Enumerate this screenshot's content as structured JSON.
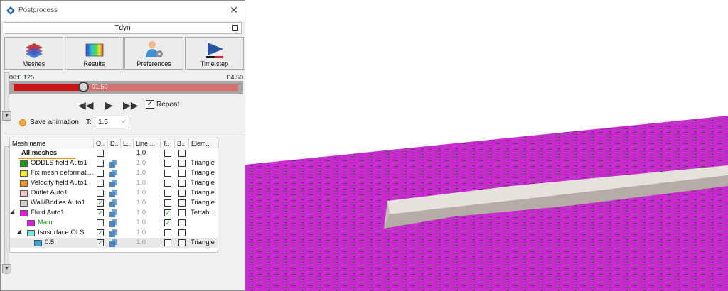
{
  "window": {
    "title": "Postprocess",
    "close_glyph": "✕"
  },
  "model": {
    "name": "Tdyn"
  },
  "toolbar": [
    {
      "label": "Meshes",
      "icon": "layers-icon"
    },
    {
      "label": "Results",
      "icon": "gradient-icon"
    },
    {
      "label": "Preferences",
      "icon": "user-gear-icon"
    },
    {
      "label": "Time step",
      "icon": "play-progress-icon"
    }
  ],
  "timeline": {
    "start": "00:0.125",
    "end": "04.50",
    "current": "01.50",
    "progress": 0.31
  },
  "playback": {
    "rewind": "◀◀",
    "play": "▶",
    "forward": "▶▶",
    "repeat_label": "Repeat",
    "repeat_checked": true
  },
  "animation": {
    "save_label": "Save animation",
    "t_label": "T:",
    "t_value": "1.5"
  },
  "table": {
    "headers": [
      "Mesh name",
      "O..",
      "D..",
      "L..",
      "Line ...",
      "T..",
      "B..",
      "Elem..."
    ],
    "all_meshes": {
      "label": "All meshes",
      "line": "1.0"
    },
    "rows": [
      {
        "name": "ODDLS field Auto1",
        "color": "#1a9b1a",
        "o": false,
        "line": "1.0",
        "t": false,
        "b": false,
        "elem": "Triangle",
        "indent": 0
      },
      {
        "name": "Fix mesh deformati...",
        "color": "#f5f032",
        "o": false,
        "line": "1.0",
        "t": false,
        "b": false,
        "elem": "Triangle",
        "indent": 0
      },
      {
        "name": "Velocity field Auto1",
        "color": "#f59a2a",
        "o": false,
        "line": "1.0",
        "t": false,
        "b": false,
        "elem": "Triangle",
        "indent": 0
      },
      {
        "name": "Outlet Auto1",
        "color": "#f7c8c8",
        "o": false,
        "line": "1.0",
        "t": false,
        "b": false,
        "elem": "Triangle",
        "indent": 0
      },
      {
        "name": "Wall/Bodies Auto1",
        "color": "#d8cfc0",
        "o": true,
        "line": "1.0",
        "t": false,
        "b": false,
        "elem": "Triangle",
        "indent": 0
      },
      {
        "name": "Fluid Auto1",
        "color": "#e21be2",
        "o": true,
        "line": "1.0",
        "t": true,
        "b": false,
        "elem": "Tetrah...",
        "indent": 0,
        "expanded": true
      },
      {
        "name": "Main",
        "color": "#e21be2",
        "o": false,
        "line": "1.0",
        "t": true,
        "b": false,
        "elem": "",
        "indent": 1,
        "green": true
      },
      {
        "name": "Isosurface OLS",
        "color": "#7ee0d6",
        "o": true,
        "line": "1.0",
        "t": false,
        "b": false,
        "elem": "",
        "indent": 1,
        "expanded": true
      },
      {
        "name": "0.5",
        "color": "#3fa6d8",
        "o": true,
        "line": "1.0",
        "t": false,
        "b": false,
        "elem": "Triangle",
        "indent": 2,
        "selected": true
      }
    ]
  },
  "colors": {
    "surface": "#c82bd0",
    "hull": "#dcd6cf",
    "accent": "#c81414"
  }
}
